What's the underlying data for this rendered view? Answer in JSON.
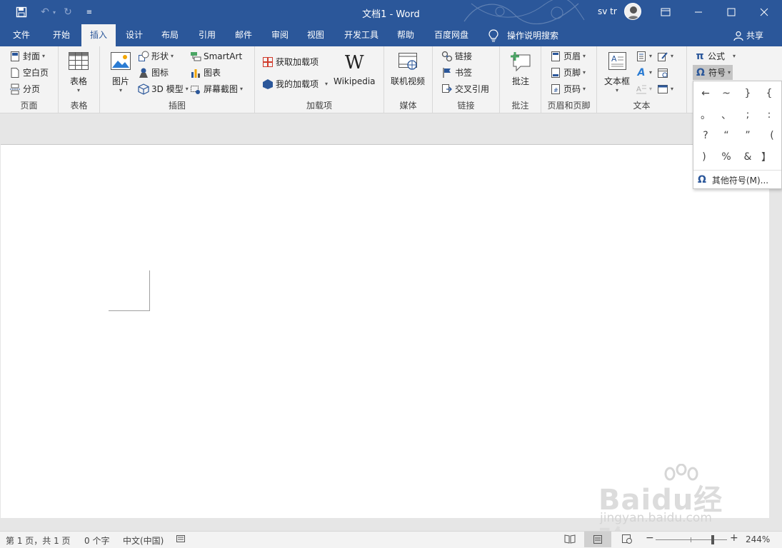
{
  "titlebar": {
    "title": "文档1  -  Word",
    "user_name": "sv tr",
    "quick_access": [
      "save-icon",
      "undo-icon",
      "redo-icon",
      "customize-icon"
    ]
  },
  "tabs": [
    "文件",
    "开始",
    "插入",
    "设计",
    "布局",
    "引用",
    "邮件",
    "审阅",
    "视图",
    "开发工具",
    "帮助",
    "百度网盘"
  ],
  "active_tab": "插入",
  "tell_me": "操作说明搜索",
  "share": "共享",
  "ribbon": {
    "pages": {
      "label": "页面",
      "cover": "封面",
      "blank": "空白页",
      "break": "分页"
    },
    "tables": {
      "label": "表格",
      "table": "表格"
    },
    "illustrations": {
      "label": "插图",
      "pictures": "图片",
      "shapes": "形状",
      "icons": "图标",
      "model3d": "3D 模型",
      "smartart": "SmartArt",
      "chart": "图表",
      "screenshot": "屏幕截图"
    },
    "addins": {
      "label": "加载项",
      "get": "获取加载项",
      "mine": "我的加载项",
      "wikipedia": "Wikipedia"
    },
    "media": {
      "label": "媒体",
      "video": "联机视频"
    },
    "links": {
      "label": "链接",
      "link": "链接",
      "bookmark": "书签",
      "crossref": "交叉引用"
    },
    "comments": {
      "label": "批注",
      "comment": "批注"
    },
    "header_footer": {
      "label": "页眉和页脚",
      "header": "页眉",
      "footer": "页脚",
      "page_number": "页码"
    },
    "text": {
      "label": "文本",
      "textbox": "文本框"
    },
    "symbols": {
      "equation": "公式",
      "symbol": "符号"
    }
  },
  "symbol_panel": {
    "symbols": [
      "←",
      "~",
      "}",
      "{",
      "。",
      "、",
      ";",
      ":",
      "?",
      "“",
      "”",
      "(",
      ")",
      "%",
      "&",
      "】"
    ],
    "more": "其他符号(M)..."
  },
  "statusbar": {
    "page_info": "第 1 页，共 1 页",
    "word_count": "0 个字",
    "language": "中文(中国)",
    "zoom": "244%",
    "zoom_fraction": 0.8
  },
  "watermark": {
    "brand": "Baidu经验",
    "url": "jingyan.baidu.com"
  },
  "colors": {
    "accent": "#2b579a",
    "ribbon_bg": "#f3f3f3",
    "page": "#ffffff"
  }
}
